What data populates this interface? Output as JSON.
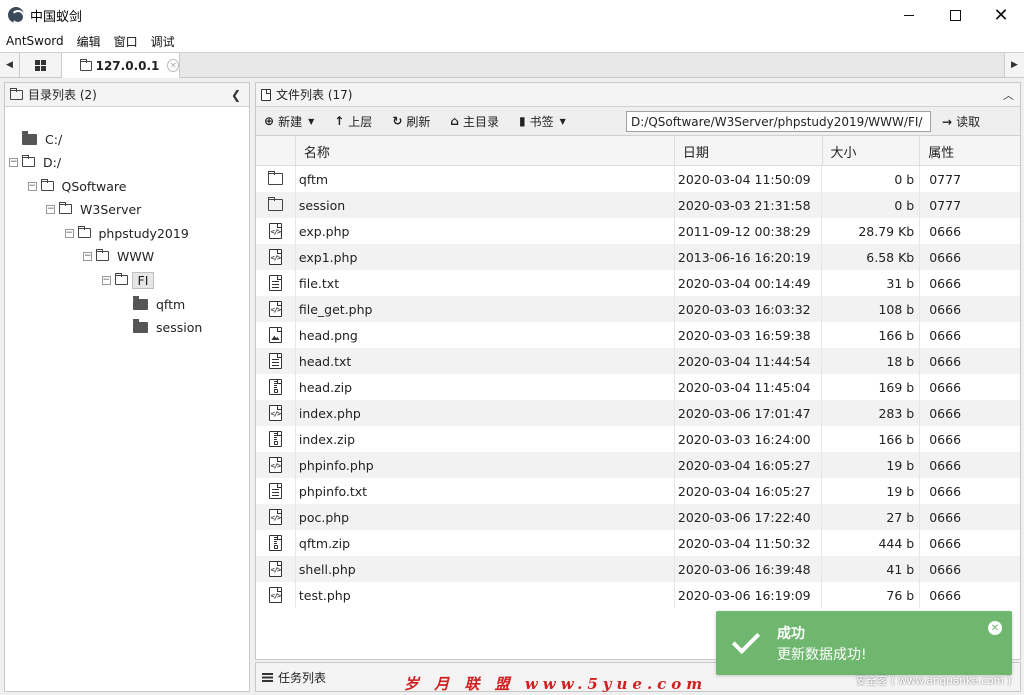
{
  "window": {
    "title": "中国蚁剑",
    "controls": {
      "minimize": "",
      "maximize": "",
      "close": "✕"
    }
  },
  "menu": [
    "AntSword",
    "编辑",
    "窗口",
    "调试"
  ],
  "tabs": {
    "active": {
      "label": "127.0.0.1",
      "close": "✕"
    }
  },
  "directory_panel": {
    "header": "目录列表 (2)",
    "tree": [
      {
        "label": "C:/",
        "level": 0,
        "solid": true,
        "toggle": ""
      },
      {
        "label": "D:/",
        "level": 0,
        "solid": false,
        "toggle": "−"
      },
      {
        "label": "QSoftware",
        "level": 1,
        "solid": false,
        "toggle": "−"
      },
      {
        "label": "W3Server",
        "level": 2,
        "solid": false,
        "toggle": "−"
      },
      {
        "label": "phpstudy2019",
        "level": 3,
        "solid": false,
        "toggle": "−"
      },
      {
        "label": "WWW",
        "level": 4,
        "solid": false,
        "toggle": "−"
      },
      {
        "label": "FI",
        "level": 5,
        "solid": false,
        "toggle": "−",
        "selected": true
      },
      {
        "label": "qftm",
        "level": 6,
        "solid": true,
        "toggle": ""
      },
      {
        "label": "session",
        "level": 6,
        "solid": true,
        "toggle": ""
      }
    ]
  },
  "file_panel": {
    "header": "文件列表 (17)",
    "toolbar": {
      "new": "新建",
      "up": "上层",
      "refresh": "刷新",
      "home": "主目录",
      "bookmark": "书签",
      "path": "D:/QSoftware/W3Server/phpstudy2019/WWW/FI/",
      "read": "读取"
    },
    "columns": {
      "name": "名称",
      "date": "日期",
      "size": "大小",
      "attr": "属性"
    },
    "rows": [
      {
        "type": "folder",
        "name": "qftm",
        "date": "2020-03-04 11:50:09",
        "size": "0 b",
        "attr": "0777"
      },
      {
        "type": "folder",
        "name": "session",
        "date": "2020-03-03 21:31:58",
        "size": "0 b",
        "attr": "0777"
      },
      {
        "type": "code",
        "name": "exp.php",
        "date": "2011-09-12 00:38:29",
        "size": "28.79 Kb",
        "attr": "0666"
      },
      {
        "type": "code",
        "name": "exp1.php",
        "date": "2013-06-16 16:20:19",
        "size": "6.58 Kb",
        "attr": "0666"
      },
      {
        "type": "text",
        "name": "file.txt",
        "date": "2020-03-04 00:14:49",
        "size": "31 b",
        "attr": "0666"
      },
      {
        "type": "code",
        "name": "file_get.php",
        "date": "2020-03-03 16:03:32",
        "size": "108 b",
        "attr": "0666"
      },
      {
        "type": "image",
        "name": "head.png",
        "date": "2020-03-03 16:59:38",
        "size": "166 b",
        "attr": "0666"
      },
      {
        "type": "text",
        "name": "head.txt",
        "date": "2020-03-04 11:44:54",
        "size": "18 b",
        "attr": "0666"
      },
      {
        "type": "zip",
        "name": "head.zip",
        "date": "2020-03-04 11:45:04",
        "size": "169 b",
        "attr": "0666"
      },
      {
        "type": "code",
        "name": "index.php",
        "date": "2020-03-06 17:01:47",
        "size": "283 b",
        "attr": "0666"
      },
      {
        "type": "zip",
        "name": "index.zip",
        "date": "2020-03-03 16:24:00",
        "size": "166 b",
        "attr": "0666"
      },
      {
        "type": "code",
        "name": "phpinfo.php",
        "date": "2020-03-04 16:05:27",
        "size": "19 b",
        "attr": "0666"
      },
      {
        "type": "text",
        "name": "phpinfo.txt",
        "date": "2020-03-04 16:05:27",
        "size": "19 b",
        "attr": "0666"
      },
      {
        "type": "code",
        "name": "poc.php",
        "date": "2020-03-06 17:22:40",
        "size": "27 b",
        "attr": "0666"
      },
      {
        "type": "zip",
        "name": "qftm.zip",
        "date": "2020-03-04 11:50:32",
        "size": "444 b",
        "attr": "0666"
      },
      {
        "type": "code",
        "name": "shell.php",
        "date": "2020-03-06 16:39:48",
        "size": "41 b",
        "attr": "0666"
      },
      {
        "type": "code",
        "name": "test.php",
        "date": "2020-03-06 16:19:09",
        "size": "76 b",
        "attr": "0666"
      }
    ]
  },
  "task_panel": {
    "label": "任务列表"
  },
  "toast": {
    "title": "成功",
    "message": "更新数据成功!"
  },
  "watermarks": {
    "left": "岁 月 联 盟 www.5yue.com",
    "right": "安全客 ( www.anquanke.com )"
  },
  "colors": {
    "toast_bg": "#6fb66f",
    "watermark_red": "#d02020",
    "row_alt": "#f2f2f2"
  }
}
